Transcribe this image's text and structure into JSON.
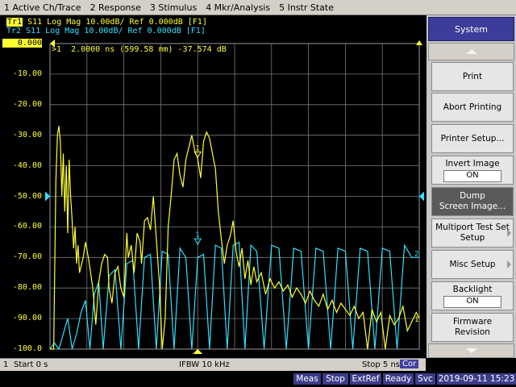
{
  "menu": [
    "1 Active Ch/Trace",
    "2 Response",
    "3 Stimulus",
    "4 Mkr/Analysis",
    "5 Instr State"
  ],
  "traces": {
    "tr1_tag": "Tr1",
    "tr1_text": " S11 Log Mag 10.00dB/ Ref 0.000dB [F1]",
    "tr2_text": "Tr2 S11 Log Mag 10.00dB/ Ref 0.000dB [F1]",
    "tr1_color": "#ffff30",
    "tr2_color": "#30e0ff",
    "tr1_end_label": "1",
    "tr2_end_label": "2"
  },
  "marker": {
    "readout": ">1  2.0000 ns (599.58 mm) -37.574 dB",
    "label": "1",
    "x_ns": 2.0,
    "y_db": -37.574
  },
  "y_axis": {
    "labels": [
      "0.000",
      "-10.00",
      "-20.00",
      "-30.00",
      "-40.00",
      "-50.00",
      "-60.00",
      "-70.00",
      "-80.00",
      "-90.00",
      "-100.0"
    ],
    "min": -100,
    "max": 0,
    "step": 10
  },
  "chart_data": {
    "type": "line",
    "x_start_ns": 0,
    "x_stop_ns": 5,
    "series": [
      {
        "name": "Tr1",
        "x": [
          0.0,
          0.05,
          0.08,
          0.1,
          0.12,
          0.14,
          0.16,
          0.18,
          0.2,
          0.22,
          0.24,
          0.26,
          0.28,
          0.3,
          0.32,
          0.34,
          0.36,
          0.38,
          0.4,
          0.45,
          0.48,
          0.52,
          0.55,
          0.58,
          0.62,
          0.66,
          0.7,
          0.74,
          0.78,
          0.8,
          0.84,
          0.88,
          0.92,
          0.96,
          1.0,
          1.04,
          1.06,
          1.1,
          1.14,
          1.18,
          1.22,
          1.24,
          1.28,
          1.32,
          1.36,
          1.4,
          1.44,
          1.48,
          1.52,
          1.56,
          1.6,
          1.64,
          1.68,
          1.72,
          1.76,
          1.8,
          1.84,
          1.88,
          1.92,
          1.96,
          2.0,
          2.04,
          2.08,
          2.12,
          2.16,
          2.2,
          2.24,
          2.28,
          2.32,
          2.36,
          2.4,
          2.44,
          2.48,
          2.52,
          2.56,
          2.6,
          2.64,
          2.68,
          2.72,
          2.76,
          2.8,
          2.86,
          2.92,
          2.98,
          3.04,
          3.1,
          3.16,
          3.22,
          3.28,
          3.34,
          3.4,
          3.46,
          3.52,
          3.58,
          3.64,
          3.7,
          3.76,
          3.82,
          3.88,
          3.94,
          4.0,
          4.06,
          4.12,
          4.18,
          4.24,
          4.3,
          4.36,
          4.42,
          4.48,
          4.54,
          4.6,
          4.66,
          4.72,
          4.78,
          4.84,
          4.9,
          4.96,
          5.0
        ],
        "values": [
          -100,
          -100,
          -45,
          -30,
          -27,
          -32,
          -50,
          -36,
          -55,
          -40,
          -62,
          -38,
          -50,
          -58,
          -67,
          -60,
          -72,
          -66,
          -75,
          -70,
          -65,
          -70,
          -75,
          -80,
          -92,
          -78,
          -72,
          -69,
          -70,
          -80,
          -85,
          -75,
          -73,
          -80,
          -83,
          -62,
          -70,
          -66,
          -75,
          -62,
          -65,
          -72,
          -58,
          -57,
          -61,
          -50,
          -64,
          -78,
          -100,
          -90,
          -60,
          -50,
          -38,
          -36,
          -43,
          -47,
          -38,
          -34,
          -30,
          -35,
          -37.6,
          -44,
          -32,
          -29,
          -31,
          -36,
          -41,
          -55,
          -64,
          -72,
          -66,
          -63,
          -58,
          -68,
          -73,
          -67,
          -77,
          -71,
          -79,
          -73,
          -78,
          -75,
          -82,
          -77,
          -80,
          -78,
          -81,
          -79,
          -83,
          -80,
          -82,
          -85,
          -81,
          -84,
          -86,
          -82,
          -87,
          -84,
          -88,
          -85,
          -87,
          -89,
          -86,
          -90,
          -88,
          -100,
          -87,
          -91,
          -88,
          -100,
          -89,
          -92,
          -90,
          -86,
          -94,
          -91,
          -88,
          -90
        ]
      },
      {
        "name": "Tr2",
        "x": [
          0.0,
          0.06,
          0.12,
          0.18,
          0.24,
          0.3,
          0.36,
          0.42,
          0.48,
          0.54,
          0.6,
          0.66,
          0.72,
          0.8,
          0.88,
          0.96,
          1.04,
          1.12,
          1.2,
          1.28,
          1.36,
          1.44,
          1.52,
          1.6,
          1.68,
          1.76,
          1.84,
          1.92,
          2.0,
          2.08,
          2.16,
          2.24,
          2.32,
          2.4,
          2.48,
          2.56,
          2.64,
          2.72,
          2.8,
          2.9,
          3.0,
          3.1,
          3.2,
          3.3,
          3.4,
          3.5,
          3.6,
          3.7,
          3.8,
          3.9,
          4.0,
          4.1,
          4.2,
          4.3,
          4.4,
          4.5,
          4.6,
          4.7,
          4.8,
          4.9,
          5.0
        ],
        "values": [
          -100,
          -98,
          -100,
          -95,
          -90,
          -100,
          -95,
          -88,
          -84,
          -100,
          -82,
          -78,
          -100,
          -76,
          -74,
          -100,
          -72,
          -71,
          -100,
          -70,
          -69,
          -100,
          -68,
          -69,
          -100,
          -67,
          -70,
          -100,
          -70,
          -69,
          -100,
          -66,
          -67,
          -100,
          -66,
          -65,
          -100,
          -66,
          -68,
          -100,
          -66,
          -67,
          -100,
          -67,
          -68,
          -100,
          -67,
          -68,
          -100,
          -67,
          -68,
          -100,
          -67,
          -68,
          -100,
          -67,
          -68,
          -100,
          -66,
          -70,
          -70
        ]
      }
    ]
  },
  "softkeys": {
    "title": "System",
    "print": "Print",
    "abort_printing": "Abort Printing",
    "printer_setup": "Printer Setup...",
    "invert_image": "Invert Image",
    "invert_image_state": "ON",
    "dump_line1": "Dump",
    "dump_line2": "Screen Image...",
    "multiport_line1": "Multiport Test Set",
    "multiport_line2": "Setup",
    "misc_setup": "Misc Setup",
    "backlight": "Backlight",
    "backlight_state": "ON",
    "firmware_line1": "Firmware",
    "firmware_line2": "Revision"
  },
  "channel": {
    "number": "1",
    "start": "Start 0 s",
    "ifbw": "IFBW 10 kHz",
    "stop": "Stop 5 ns",
    "cor": "Cor"
  },
  "status": {
    "meas": "Meas",
    "stop": "Stop",
    "extref": "ExtRef",
    "ready": "Ready",
    "svc": "Svc",
    "datetime": "2019-09-11 15:23"
  }
}
